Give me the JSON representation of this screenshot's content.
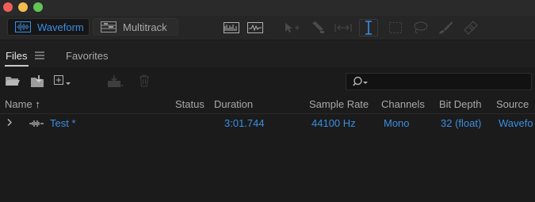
{
  "window": {
    "traffic_lights": [
      "close",
      "minimize",
      "zoom"
    ]
  },
  "toolbar": {
    "waveform_label": "Waveform",
    "multitrack_label": "Multitrack",
    "active_mode": "Waveform",
    "accent_color": "#3a8ee6",
    "tools": [
      "spectral-frequency-display-icon",
      "spectral-pitch-display-icon",
      "move-tool-icon",
      "razor-tool-icon",
      "slip-tool-icon",
      "time-selection-tool-icon",
      "marquee-selection-tool-icon",
      "lasso-selection-tool-icon",
      "brush-selection-tool-icon",
      "spot-healing-brush-icon"
    ]
  },
  "panel": {
    "tabs": [
      {
        "label": "Files",
        "active": true
      },
      {
        "label": "Favorites",
        "active": false
      }
    ],
    "actions": [
      "open-file-icon",
      "import-file-icon",
      "new-file-icon",
      "insert-into-multitrack-icon",
      "delete-icon"
    ],
    "search_icon": "search-icon"
  },
  "table": {
    "columns": [
      "Name",
      "Status",
      "Duration",
      "Sample Rate",
      "Channels",
      "Bit Depth",
      "Source"
    ],
    "sort_indicator": "↑",
    "rows": [
      {
        "name": "Test *",
        "status": "",
        "duration": "3:01.744",
        "sample_rate": "44100 Hz",
        "channels": "Mono",
        "bit_depth": "32 (float)",
        "source": "Wavefo"
      }
    ]
  }
}
